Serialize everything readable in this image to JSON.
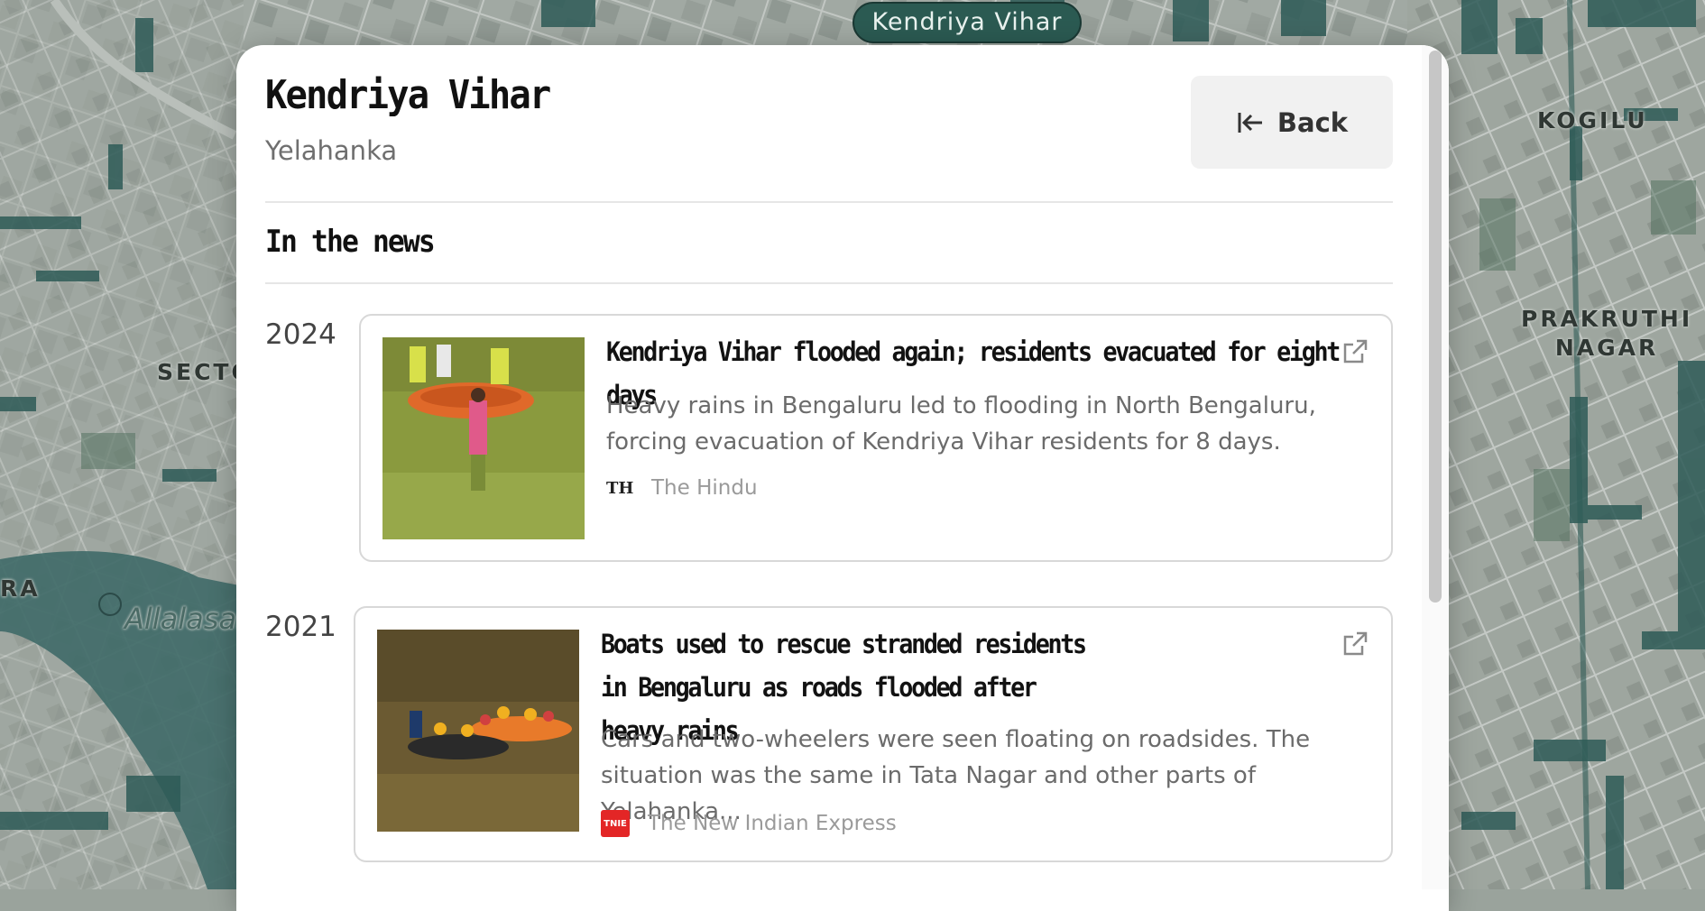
{
  "map": {
    "pin_label": "Kendriya Vihar",
    "labels": {
      "kogilu": "KOGILU",
      "prakruthi_nagar": "PRAKRUTHI\nNAGAR",
      "sector": "SECTO",
      "ra": "RA",
      "allalasandra": "Allalasan"
    }
  },
  "panel": {
    "title": "Kendriya Vihar",
    "subtitle": "Yelahanka",
    "back_label": "Back",
    "section_title": "In the news"
  },
  "news": [
    {
      "year": "2024",
      "headline": "Kendriya Vihar flooded again; residents evacuated for eight days",
      "description": "Heavy rains in Bengaluru led to flooding in North Bengaluru, forcing evacuation of Kendriya Vihar residents for 8 days.",
      "source_logo": "TH",
      "source": "The Hindu"
    },
    {
      "year": "2021",
      "headline": "Boats used to rescue stranded residents in Bengaluru as roads flooded after heavy rains",
      "description": "Cars and two-wheelers were seen floating on roadsides. The situation was the same in Tata Nagar and other parts of Yelahanka...",
      "source_logo": "TNIE",
      "source": "The New Indian Express"
    }
  ],
  "colors": {
    "map_base": "#9aa39c",
    "map_water": "#3f6a68",
    "flood_dark": "#2e5b57",
    "pin_bg": "#2b5a52",
    "tnie_red": "#e32626"
  },
  "icons": [
    "back-arrow-icon",
    "external-link-icon"
  ]
}
